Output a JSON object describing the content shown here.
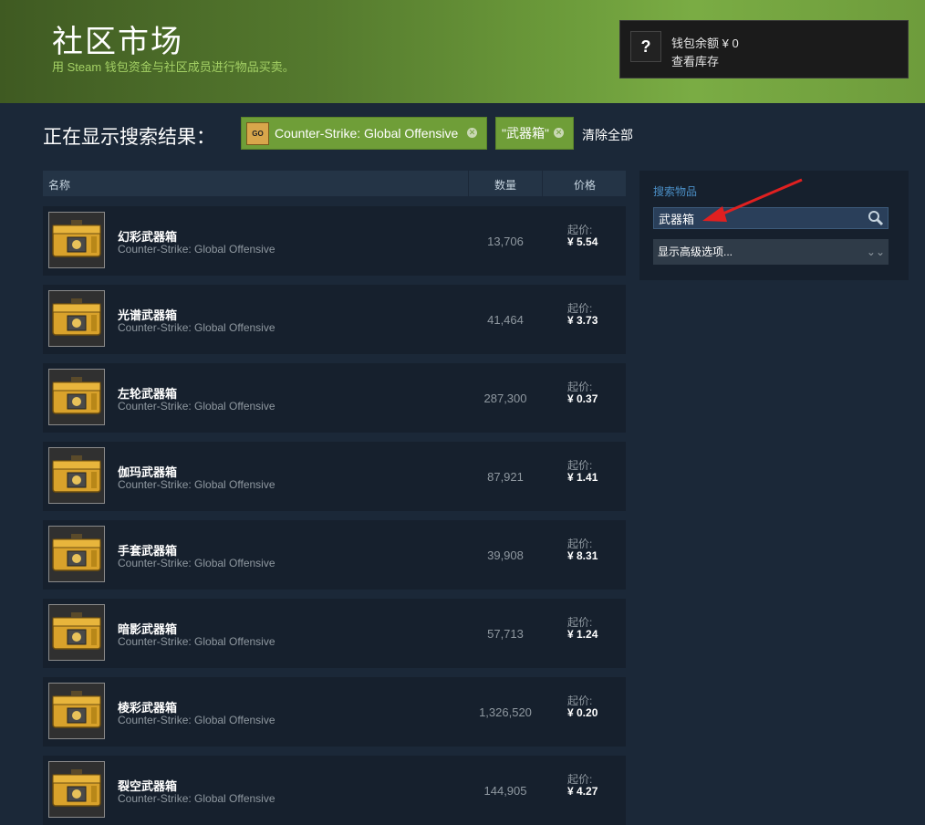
{
  "header": {
    "title": "社区市场",
    "subtitle": "用 Steam 钱包资金与社区成员进行物品买卖。"
  },
  "wallet": {
    "avatar_glyph": "?",
    "balance_text": "钱包余额 ¥ 0",
    "inventory_link": "查看库存"
  },
  "filters": {
    "results_label": "正在显示搜索结果：",
    "game_chip": "Counter-Strike: Global Offensive",
    "game_icon_text": "GO",
    "term_chip": "\"武器箱\"",
    "clear_all": "清除全部"
  },
  "columns": {
    "name": "名称",
    "quantity": "数量",
    "price": "价格"
  },
  "listings": [
    {
      "name": "幻彩武器箱",
      "game": "Counter-Strike: Global Offensive",
      "quantity": "13,706",
      "starting_label": "起价:",
      "price": "¥ 5.54"
    },
    {
      "name": "光谱武器箱",
      "game": "Counter-Strike: Global Offensive",
      "quantity": "41,464",
      "starting_label": "起价:",
      "price": "¥ 3.73"
    },
    {
      "name": "左轮武器箱",
      "game": "Counter-Strike: Global Offensive",
      "quantity": "287,300",
      "starting_label": "起价:",
      "price": "¥ 0.37"
    },
    {
      "name": "伽玛武器箱",
      "game": "Counter-Strike: Global Offensive",
      "quantity": "87,921",
      "starting_label": "起价:",
      "price": "¥ 1.41"
    },
    {
      "name": "手套武器箱",
      "game": "Counter-Strike: Global Offensive",
      "quantity": "39,908",
      "starting_label": "起价:",
      "price": "¥ 8.31"
    },
    {
      "name": "暗影武器箱",
      "game": "Counter-Strike: Global Offensive",
      "quantity": "57,713",
      "starting_label": "起价:",
      "price": "¥ 1.24"
    },
    {
      "name": "棱彩武器箱",
      "game": "Counter-Strike: Global Offensive",
      "quantity": "1,326,520",
      "starting_label": "起价:",
      "price": "¥ 0.20"
    },
    {
      "name": "裂空武器箱",
      "game": "Counter-Strike: Global Offensive",
      "quantity": "144,905",
      "starting_label": "起价:",
      "price": "¥ 4.27"
    }
  ],
  "search": {
    "label": "搜索物品",
    "value": "武器箱",
    "advanced_label": "显示高级选项...",
    "advanced_icon": "double-chevron-down-icon"
  },
  "colors": {
    "page_bg": "#1b2838",
    "header_green": "#6b9a3a",
    "chip_green": "#6f9e38",
    "row_bg": "#16202d",
    "annotation_arrow": "#e02020"
  }
}
